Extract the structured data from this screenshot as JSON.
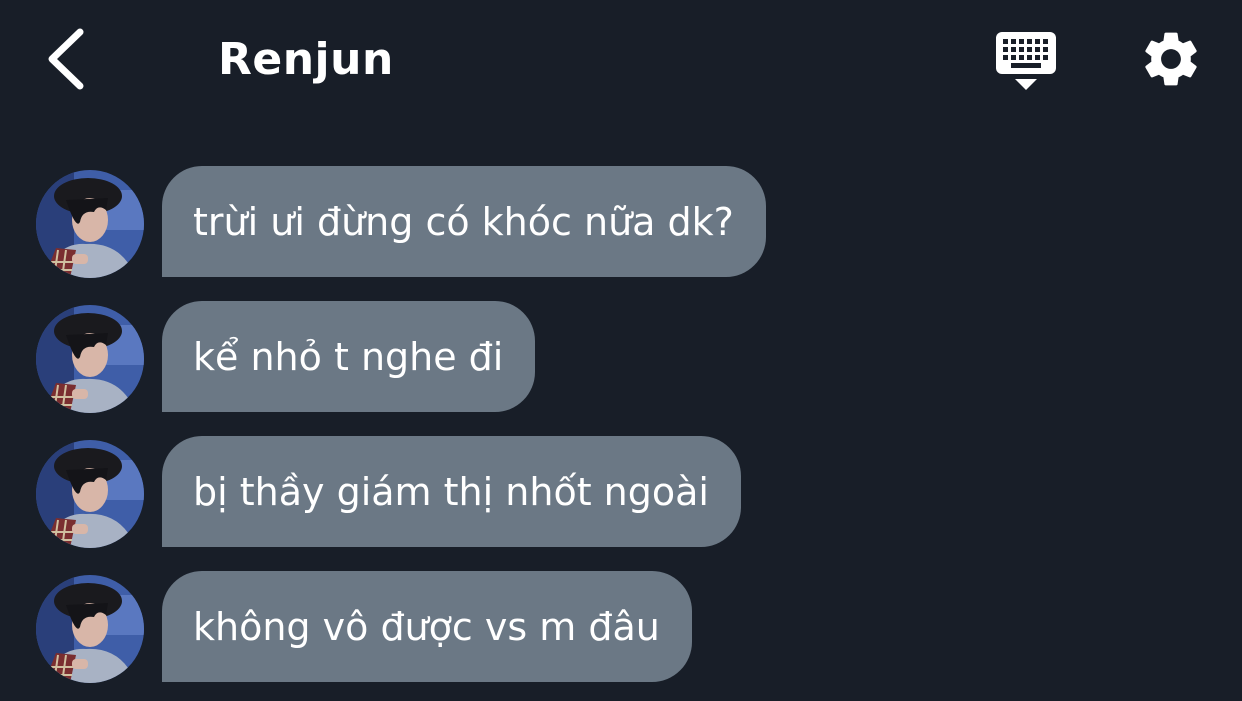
{
  "header": {
    "back_icon": "chevron-left-icon",
    "contact_name": "Renjun",
    "keyboard_icon": "keyboard-icon",
    "settings_icon": "gear-icon"
  },
  "colors": {
    "background": "#181e28",
    "bubble": "#6b7885",
    "text": "#ffffff"
  },
  "messages": [
    {
      "text": "trừi ưi đừng có khóc nữa dk?"
    },
    {
      "text": "kể nhỏ t nghe đi"
    },
    {
      "text": "bị thầy giám thị nhốt ngoài"
    },
    {
      "text": "không vô được vs m đâu"
    }
  ]
}
